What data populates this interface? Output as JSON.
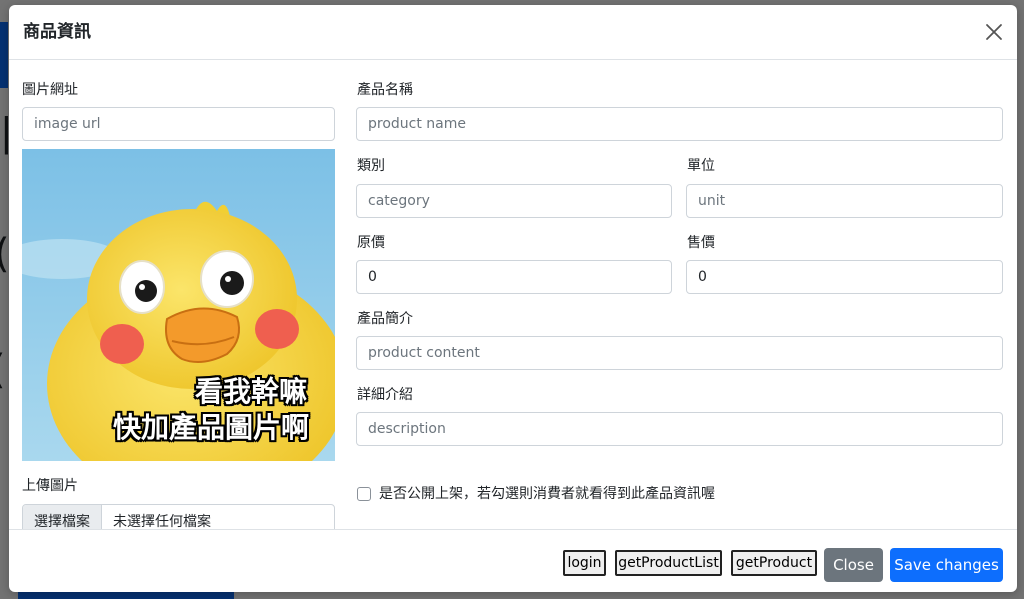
{
  "modal": {
    "title": "商品資訊"
  },
  "form": {
    "image_url": {
      "label": "圖片網址",
      "placeholder": "image url",
      "value": ""
    },
    "product_name": {
      "label": "產品名稱",
      "placeholder": "product name",
      "value": ""
    },
    "category": {
      "label": "類別",
      "placeholder": "category",
      "value": ""
    },
    "unit": {
      "label": "單位",
      "placeholder": "unit",
      "value": ""
    },
    "origin_price": {
      "label": "原價",
      "placeholder": "",
      "value": "0"
    },
    "price": {
      "label": "售價",
      "placeholder": "",
      "value": "0"
    },
    "content": {
      "label": "產品簡介",
      "placeholder": "product content",
      "value": ""
    },
    "description": {
      "label": "詳細介紹",
      "placeholder": "description",
      "value": ""
    },
    "upload": {
      "label": "上傳圖片",
      "button_label": "選擇檔案",
      "status": "未選擇任何檔案"
    },
    "is_enabled": {
      "label": "是否公開上架，若勾選則消費者就看得到此產品資訊喔",
      "checked": false
    }
  },
  "preview_image": {
    "caption_line1": "看我幹嘛",
    "caption_line2": "快加產品圖片啊"
  },
  "footer": {
    "debug_buttons": [
      "login",
      "getProductList",
      "getProduct"
    ],
    "close_label": "Close",
    "save_label": "Save changes"
  },
  "colors": {
    "primary": "#0d6efd",
    "secondary": "#6c757d",
    "border": "#ced4da",
    "sky": "#8cc9e8",
    "chick_yellow": "#f7d63a"
  }
}
